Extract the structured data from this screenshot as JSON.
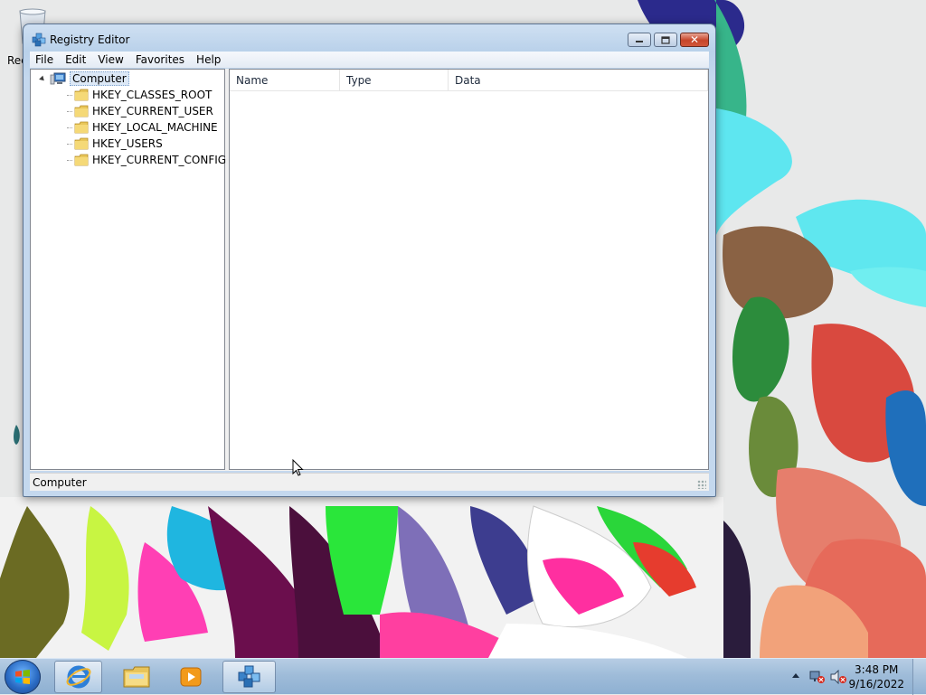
{
  "desktop": {
    "recycle_bin_label": "Rec"
  },
  "window": {
    "title": "Registry Editor",
    "caption_buttons": [
      "minimize",
      "maximize",
      "close"
    ],
    "menu": [
      "File",
      "Edit",
      "View",
      "Favorites",
      "Help"
    ],
    "tree": {
      "root": "Computer",
      "root_icon": "computer-icon",
      "children": [
        "HKEY_CLASSES_ROOT",
        "HKEY_CURRENT_USER",
        "HKEY_LOCAL_MACHINE",
        "HKEY_USERS",
        "HKEY_CURRENT_CONFIG"
      ],
      "child_icon": "folder-icon"
    },
    "list_columns": [
      "Name",
      "Type",
      "Data"
    ],
    "status": "Computer"
  },
  "taskbar": {
    "pinned": [
      "start-orb",
      "internet-explorer-icon",
      "windows-explorer-icon",
      "media-player-icon",
      "registry-editor-icon"
    ],
    "clock_time": "3:48 PM",
    "clock_date": "9/16/2022"
  },
  "colors": {
    "titlebar": "#b9d1ea",
    "close_button": "#c6452a",
    "taskbar": "#9fbcd9",
    "selection": "#dce8f6"
  }
}
